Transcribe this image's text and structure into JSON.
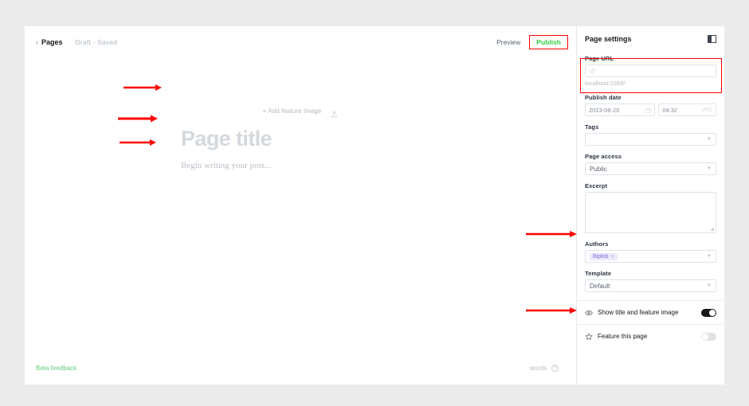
{
  "editor": {
    "back_label": "Pages",
    "back_icon": "chevron-left-icon",
    "draft_status": "Draft - Saved",
    "preview_label": "Preview",
    "publish_label": "Publish",
    "add_feature_image_label": "+ Add feature image",
    "upload_icon": "upload-image-icon",
    "title_placeholder": "Page title",
    "body_placeholder": "Begin writing your post...",
    "beta_feedback_label": "Beta feedback",
    "word_count_label": "words",
    "help_icon": "question-mark-icon"
  },
  "sidebar": {
    "title": "Page settings",
    "panel_toggle_icon": "sidebar-panel-icon",
    "page_url": {
      "label": "Page URL",
      "value": "",
      "icon": "link-icon",
      "hint": "localhost:2368/"
    },
    "publish_date": {
      "label": "Publish date",
      "date_value": "2023-08-20",
      "date_icon": "calendar-icon",
      "time_value": "04:32",
      "timezone": "UTC"
    },
    "tags": {
      "label": "Tags",
      "value": "",
      "caret_icon": "chevron-down-icon"
    },
    "page_access": {
      "label": "Page access",
      "value": "Public",
      "caret_icon": "chevron-down-icon"
    },
    "excerpt": {
      "label": "Excerpt",
      "value": "",
      "resize_icon": "resize-grip-icon"
    },
    "authors": {
      "label": "Authors",
      "chip_name": "Biplob",
      "chip_remove_icon": "remove-x-icon",
      "caret_icon": "chevron-down-icon"
    },
    "template": {
      "label": "Template",
      "value": "Default",
      "caret_icon": "chevron-down-icon"
    },
    "toggles": [
      {
        "icon": "eye-icon",
        "label": "Show title and feature image",
        "state": "on"
      },
      {
        "icon": "star-icon",
        "label": "Feature this page",
        "state": "off"
      }
    ]
  },
  "colors": {
    "annotation": "#ff0000",
    "publish_green": "#30cf43",
    "beta_green": "#5fcc7d",
    "author_chip_bg": "#eeeafd",
    "author_chip_text": "#7d6ad6",
    "canvas_bg": "#ebebeb",
    "app_bg": "#ffffff"
  }
}
